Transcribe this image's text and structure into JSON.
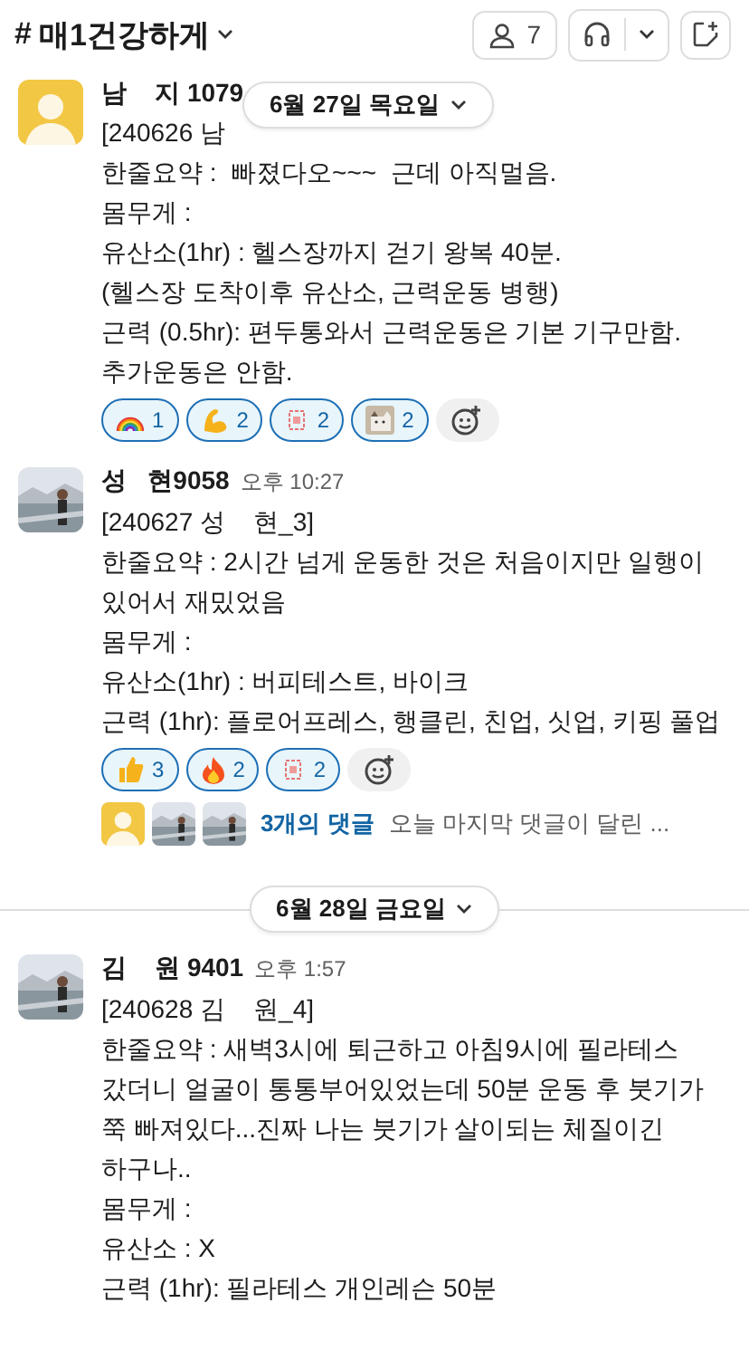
{
  "header": {
    "hash": "#",
    "channel": "매1건강하게",
    "member_count": "7"
  },
  "sticky_date": "6월 27일 목요일",
  "messages": [
    {
      "author": "남    지 1079",
      "kind": "placeholder",
      "lines": [
        "[240626 남",
        "한줄요약 :  빠졌다오~~~  근데 아직멀음.",
        "몸무게 :",
        "유산소(1hr) : 헬스장까지 걷기 왕복 40분.",
        "(헬스장 도착이후 유산소, 근력운동 병행)",
        "근력 (0.5hr): 편두통와서 근력운동은 기본 기구만함.",
        "추가운동은 안함."
      ],
      "reactions": [
        {
          "kind": "rainbow",
          "count": "1",
          "selected": true
        },
        {
          "kind": "arm",
          "count": "2",
          "selected": true
        },
        {
          "kind": "stamp",
          "count": "2",
          "selected": true
        },
        {
          "kind": "cat",
          "count": "2",
          "selected": true
        }
      ]
    },
    {
      "author": "성   현9058",
      "time": "오후 10:27",
      "lines": [
        "[240627 성    현_3]",
        "한줄요약 : 2시간 넘게 운동한 것은 처음이지만 일행이 있어서 재밌었음",
        "몸무게 :",
        "유산소(1hr) : 버피테스트, 바이크",
        "근력 (1hr): 플로어프레스, 행클린, 친업, 싯업, 키핑 풀업"
      ],
      "reactions": [
        {
          "kind": "thumb",
          "count": "3",
          "selected": true
        },
        {
          "kind": "fire",
          "count": "2",
          "selected": true
        },
        {
          "kind": "stamp",
          "count": "2",
          "selected": true
        }
      ],
      "thread": {
        "replies": "3개의 댓글",
        "last": "오늘 마지막 댓글이 달린 ..."
      }
    },
    {
      "divider": "6월 28일 금요일",
      "author": "김    원 9401",
      "time": "오후 1:57",
      "lines": [
        "[240628 김    원_4]",
        "한줄요약 : 새벽3시에 퇴근하고 아침9시에 필라테스 갔더니 얼굴이 통통부어있었는데 50분 운동 후 붓기가 쭉 빠져있다...진짜 나는 붓기가 살이되는 체질이긴 하구나..",
        "몸무게 :",
        "유산소 : X",
        "근력 (1hr): 필라테스 개인레슨 50분"
      ]
    }
  ]
}
